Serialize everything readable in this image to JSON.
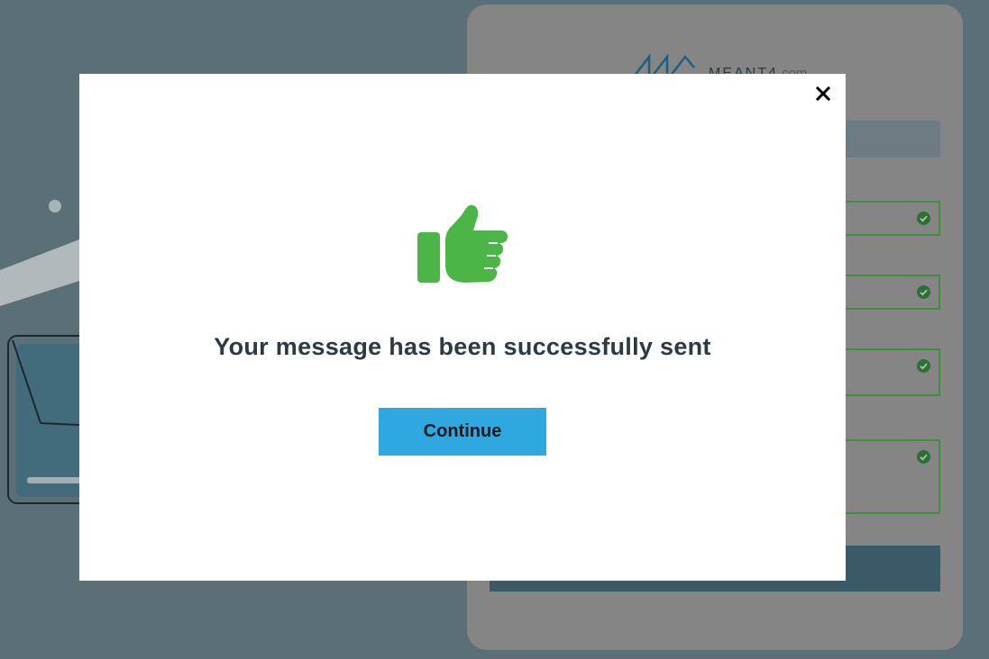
{
  "background": {
    "logo": {
      "brand": "MEANT4",
      "domain": ".com"
    }
  },
  "modal": {
    "message": "Your message has been successfully sent",
    "continue_label": "Continue",
    "icon": "thumbs-up-icon",
    "close_icon": "close-icon"
  },
  "colors": {
    "success": "#4cb548",
    "button": "#2ea8de",
    "text": "#2d3a44"
  }
}
